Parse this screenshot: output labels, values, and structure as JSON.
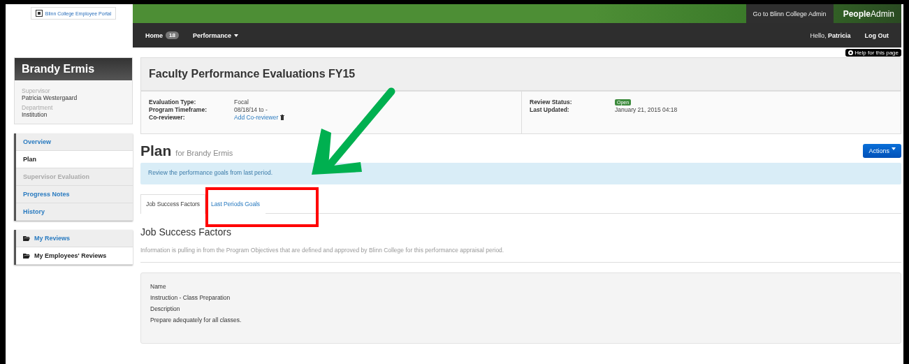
{
  "header": {
    "logo_text": "Blinn College  Employee Portal",
    "admin_link": "Go to Blinn College Admin",
    "brand": "**People**Admin",
    "nav": [
      {
        "label": "Home",
        "badge": "18",
        "kind": "badge"
      },
      {
        "label": "Performance",
        "kind": "dropdown"
      }
    ],
    "greeting": "Hello, **Patricia**",
    "logout": "Log Out"
  },
  "help": "Help for this page",
  "profile": {
    "name": "Brandy Ermis",
    "fields": [
      {
        "label": "Supervisor",
        "value": "Patricia Westergaard"
      },
      {
        "label": "Department",
        "value": "Institution"
      }
    ]
  },
  "sidebar": {
    "items": [
      {
        "label": "Overview",
        "selected": false,
        "disabled": false
      },
      {
        "label": "Plan",
        "selected": true,
        "disabled": false
      },
      {
        "label": "Supervisor Evaluation",
        "selected": false,
        "disabled": true
      },
      {
        "label": "Progress Notes",
        "selected": false,
        "disabled": false
      },
      {
        "label": "History",
        "selected": false,
        "disabled": false
      }
    ],
    "reviews": [
      {
        "label": "My Reviews",
        "selected": false
      },
      {
        "label": "My Employees' Reviews",
        "selected": true
      }
    ]
  },
  "evaluation": {
    "title": "Faculty Performance Evaluations FY15",
    "left": [
      {
        "label": "Evaluation Type:",
        "value": "Focal",
        "kind": "text"
      },
      {
        "label": "Program Timeframe:",
        "value": "08/18/14 to -",
        "kind": "text"
      },
      {
        "label": "Co-reviewer:",
        "value": "Add Co-reviewer",
        "kind": "link"
      }
    ],
    "right": [
      {
        "label": "Review Status:",
        "value": "Open",
        "kind": "badge"
      },
      {
        "label": "Last Updated:",
        "value": "January 21, 2015 04:18",
        "kind": "text"
      }
    ]
  },
  "plan": {
    "title": "Plan",
    "subtitle": "for Brandy Ermis",
    "actions": "Actions",
    "alert": "Review the performance goals from last period.",
    "tabs": [
      {
        "label": "Job Success Factors",
        "selected": true
      },
      {
        "label": "Last Periods Goals",
        "selected": false
      }
    ],
    "section_title": "Job Success Factors",
    "section_desc": "Information is pulling in from the Program Objectives that are defined and approved by Blinn College for this performance appraisal period.",
    "card": [
      {
        "label": "Name",
        "value": "Instruction - Class Preparation"
      },
      {
        "label": "Description",
        "value": "Prepare adequately for all classes."
      }
    ]
  }
}
